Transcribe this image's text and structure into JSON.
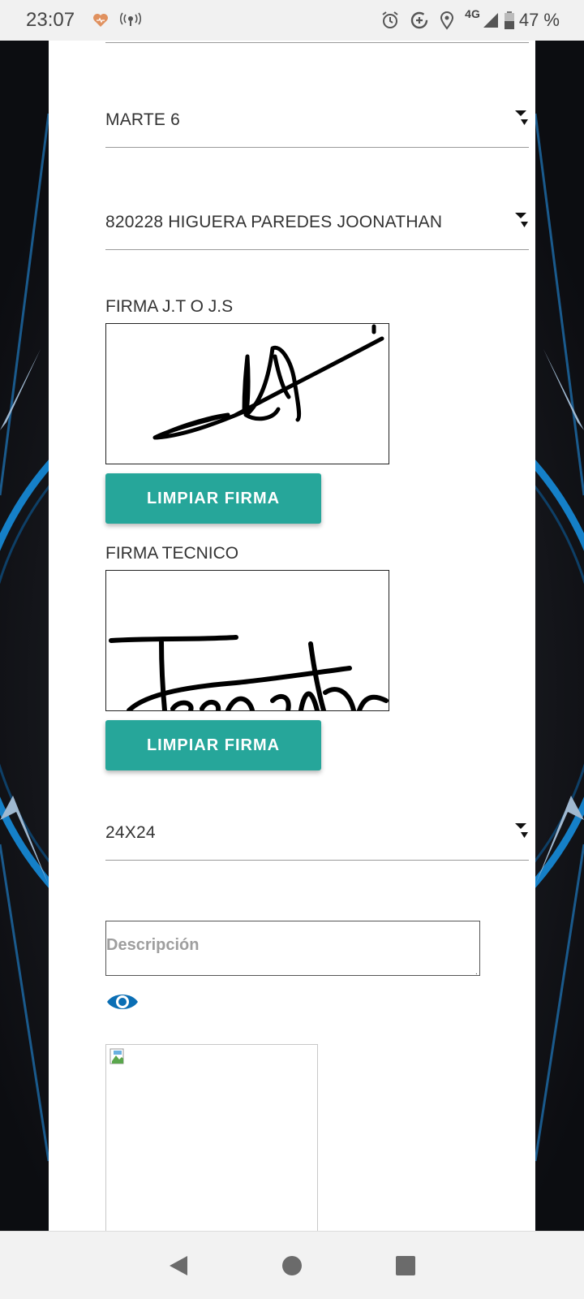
{
  "status_bar": {
    "time": "23:07",
    "network": "4G",
    "battery": "47 %",
    "icons": [
      "heart-icon",
      "hotspot-icon",
      "alarm-icon",
      "data-saver-icon",
      "location-icon",
      "signal-icon",
      "battery-icon"
    ]
  },
  "form": {
    "select_1": {
      "value": "MARTE 6"
    },
    "select_2": {
      "value": "820228 HIGUERA PAREDES JOONATHAN"
    },
    "signature_1": {
      "label": "FIRMA J.T O J.S",
      "clear_button": "LIMPIAR FIRMA"
    },
    "signature_2": {
      "label": "FIRMA TECNICO",
      "clear_button": "LIMPIAR FIRMA"
    },
    "select_3": {
      "value": "24X24"
    },
    "description": {
      "placeholder": "Descripción",
      "value": ""
    },
    "preview_icon": "eye-icon"
  },
  "navigation_bar": {
    "buttons": [
      "back-icon",
      "home-icon",
      "recents-icon"
    ]
  },
  "colors": {
    "button": "#26a69a",
    "eye_icon": "#0a6eb4",
    "background_accent": "#1580c8"
  }
}
